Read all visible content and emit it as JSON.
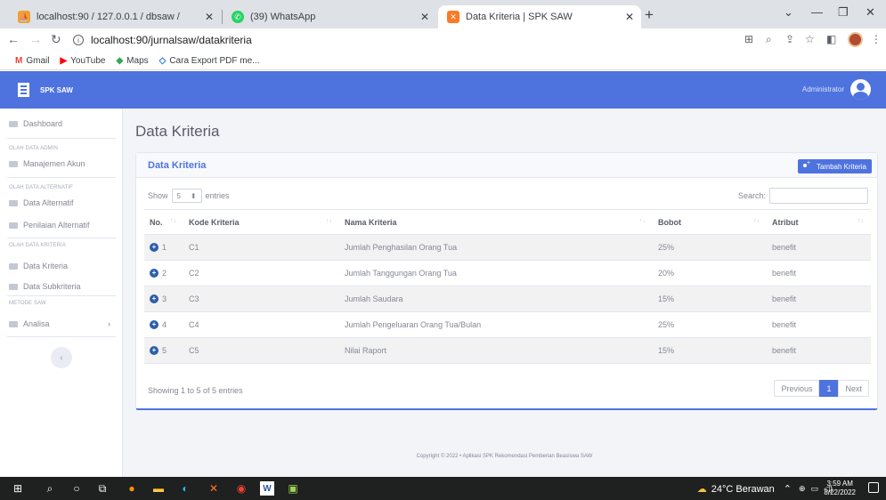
{
  "browser": {
    "tabs": [
      {
        "label": "localhost:90 / 127.0.0.1 / dbsaw /",
        "close": "✕"
      },
      {
        "label": "(39) WhatsApp",
        "close": "✕"
      },
      {
        "label": "Data Kriteria | SPK SAW",
        "close": "✕"
      }
    ],
    "new_tab": "+",
    "url": "localhost:90/jurnalsaw/datakriteria",
    "bookmarks": [
      {
        "label": "Gmail",
        "icon": "M",
        "color": "#ea4335"
      },
      {
        "label": "YouTube",
        "icon": "▶",
        "color": "#ff0000"
      },
      {
        "label": "Maps",
        "icon": "◆",
        "color": "#34a853"
      },
      {
        "label": "Cara Export PDF me...",
        "icon": "◇",
        "color": "#1a73e8"
      }
    ]
  },
  "header": {
    "brand": "SPK SAW",
    "user": "Administrator"
  },
  "sidebar": {
    "dashboard": "Dashboard",
    "sections": [
      {
        "heading": "OLAH DATA ADMIN",
        "items": [
          "Manajemen Akun"
        ]
      },
      {
        "heading": "OLAH DATA ALTERNATIF",
        "items": [
          "Data Alternatif",
          "Penilaian Alternatif"
        ]
      },
      {
        "heading": "OLAH DATA KRITERIA",
        "items": [
          "Data Kriteria",
          "Data Subkriteria"
        ]
      },
      {
        "heading": "METODE SAW",
        "items": [
          "Analisa"
        ]
      }
    ],
    "toggle": "‹"
  },
  "main": {
    "page_title": "Data Kriteria",
    "card_title": "Data Kriteria",
    "add_button": "Tambah Kriteria",
    "show_label": "Show",
    "entries_value": "5",
    "entries_label": "entries",
    "search_label": "Search:",
    "columns": [
      "No.",
      "Kode Kriteria",
      "Nama Kriteria",
      "Bobot",
      "Atribut"
    ],
    "rows": [
      {
        "no": "1",
        "kode": "C1",
        "nama": "Jumlah Penghasilan Orang Tua",
        "bobot": "25%",
        "atribut": "benefit"
      },
      {
        "no": "2",
        "kode": "C2",
        "nama": "Jumlah Tanggungan Orang Tua",
        "bobot": "20%",
        "atribut": "benefit"
      },
      {
        "no": "3",
        "kode": "C3",
        "nama": "Jumlah Saudara",
        "bobot": "15%",
        "atribut": "benefit"
      },
      {
        "no": "4",
        "kode": "C4",
        "nama": "Jumlah Pengeluaran Orang Tua/Bulan",
        "bobot": "25%",
        "atribut": "benefit"
      },
      {
        "no": "5",
        "kode": "C5",
        "nama": "Nilai Raport",
        "bobot": "15%",
        "atribut": "benefit"
      }
    ],
    "info": "Showing 1 to 5 of 5 entries",
    "pager": {
      "previous": "Previous",
      "current": "1",
      "next": "Next"
    },
    "footer": "Copyright © 2022 • Aplikasi SPK Rekomendasi Pemberian Beasiswa SAW"
  },
  "taskbar": {
    "weather": "24°C Berawan",
    "time": "3:59 AM",
    "date": "8/22/2022"
  },
  "colors": {
    "primary": "#4e73df",
    "row_stripe": "#f2f2f2",
    "row_icon": "#2e5eaa"
  }
}
